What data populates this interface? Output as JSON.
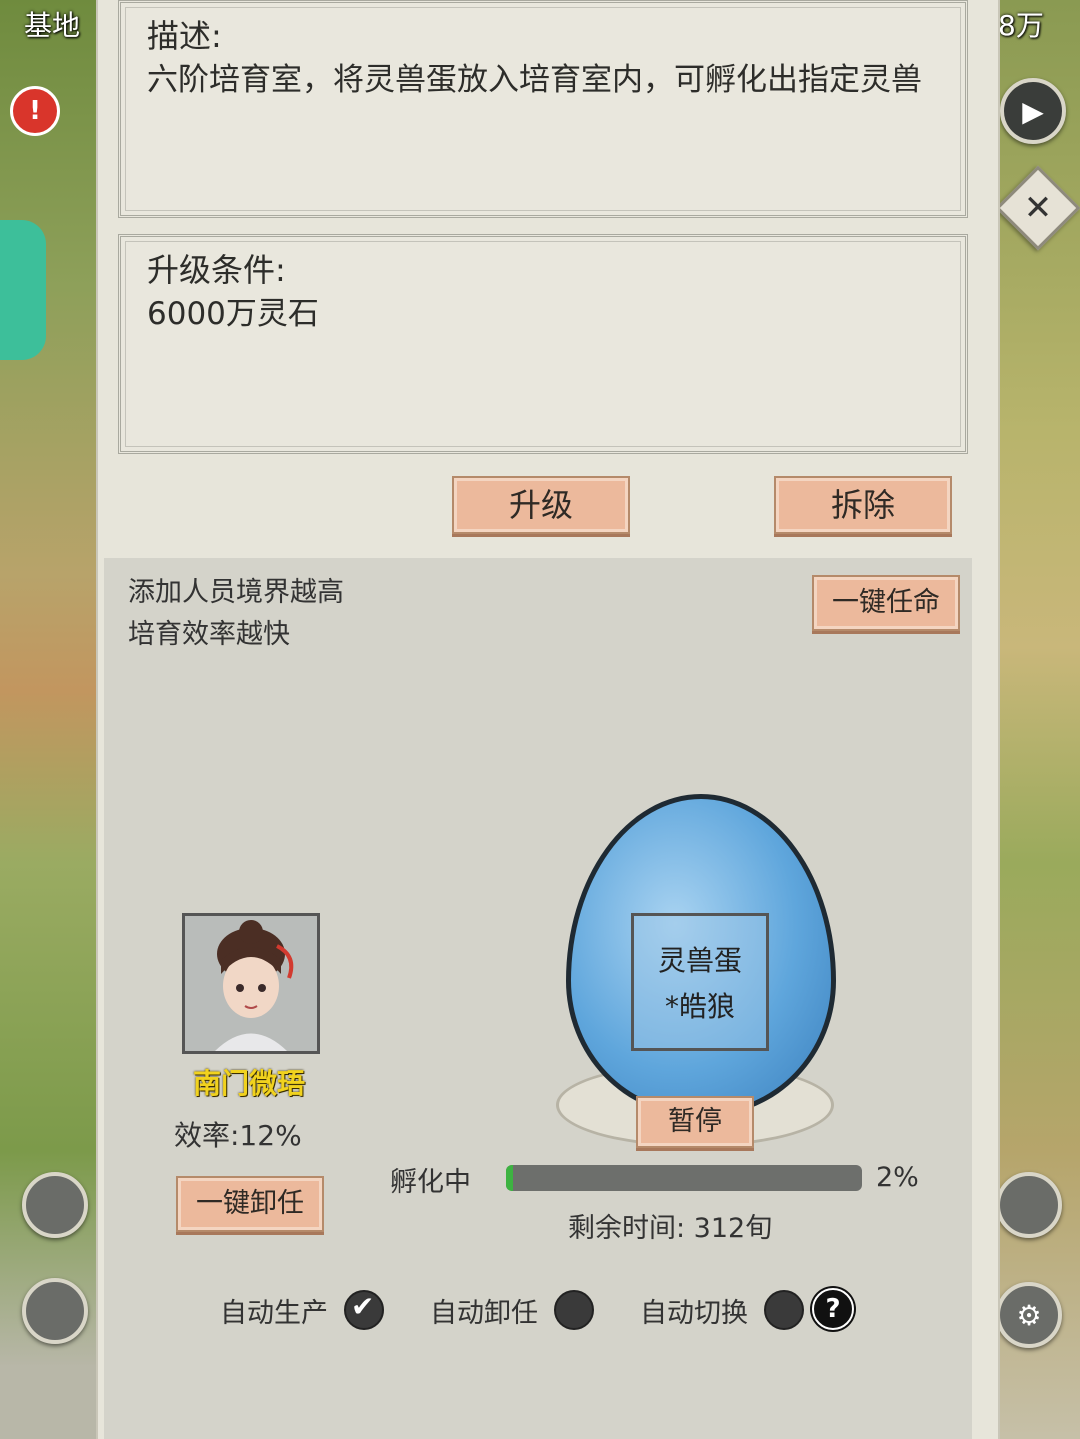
{
  "edge": {
    "left_label": "基地",
    "right_label": "8万"
  },
  "description": {
    "title": "描述:",
    "text": "六阶培育室，将灵兽蛋放入培育室内，可孵化出指定灵兽"
  },
  "upgrade": {
    "title": "升级条件:",
    "text": "6000万灵石"
  },
  "buttons": {
    "upgrade": "升级",
    "demolish": "拆除",
    "appoint_all": "一键任命",
    "dismiss_all": "一键卸任",
    "pause": "暂停"
  },
  "hint": {
    "line1": "添加人员境界越高",
    "line2": "培育效率越快"
  },
  "worker": {
    "name": "南门微珸",
    "efficiency": "效率:12%"
  },
  "egg": {
    "line1": "灵兽蛋",
    "line2": "*皓狼"
  },
  "hatch": {
    "status": "孵化中",
    "progress": 2,
    "progress_label": "2%",
    "remaining": "剩余时间:  312旬"
  },
  "toggles": {
    "auto_produce": "自动生产",
    "auto_dismiss": "自动卸任",
    "auto_switch": "自动切换",
    "help": "?"
  },
  "colors": {
    "button_bg": "#ecb99c",
    "worker_name": "#f1d21e",
    "progress_fill": "#3db341"
  }
}
